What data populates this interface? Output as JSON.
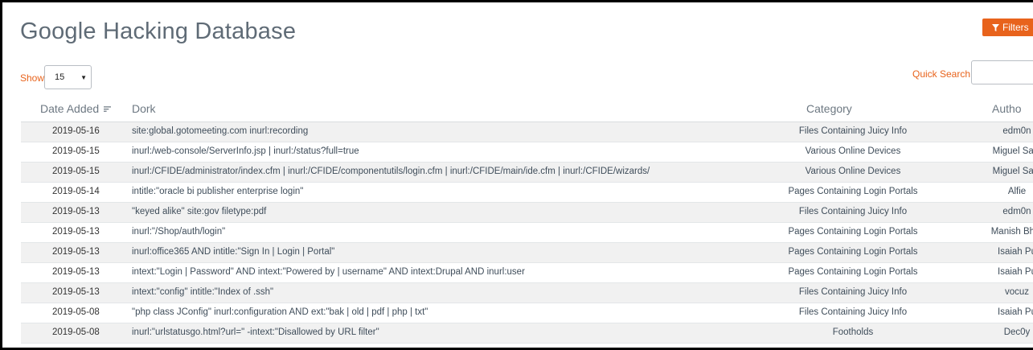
{
  "header": {
    "title": "Google Hacking Database",
    "filters_label": "Filters"
  },
  "controls": {
    "show_label": "Show",
    "show_value": "15",
    "quick_search_label": "Quick Search",
    "quick_search_value": ""
  },
  "columns": {
    "date": "Date Added",
    "dork": "Dork",
    "category": "Category",
    "author": "Autho"
  },
  "rows": [
    {
      "date": "2019-05-16",
      "dork": "site:global.gotomeeting.com inurl:recording",
      "category": "Files Containing Juicy Info",
      "author": "edm0n"
    },
    {
      "date": "2019-05-15",
      "dork": "inurl:/web-console/ServerInfo.jsp | inurl:/status?full=true",
      "category": "Various Online Devices",
      "author": "Miguel Sant"
    },
    {
      "date": "2019-05-15",
      "dork": "inurl:/CFIDE/administrator/index.cfm | inurl:/CFIDE/componentutils/login.cfm | inurl:/CFIDE/main/ide.cfm | inurl:/CFIDE/wizards/",
      "category": "Various Online Devices",
      "author": "Miguel Sant"
    },
    {
      "date": "2019-05-14",
      "dork": "intitle:\"oracle bi publisher enterprise login\"",
      "category": "Pages Containing Login Portals",
      "author": "Alfie"
    },
    {
      "date": "2019-05-13",
      "dork": "\"keyed alike\" site:gov filetype:pdf",
      "category": "Files Containing Juicy Info",
      "author": "edm0n"
    },
    {
      "date": "2019-05-13",
      "dork": "inurl:\"/Shop/auth/login\"",
      "category": "Pages Containing Login Portals",
      "author": "Manish Bhar"
    },
    {
      "date": "2019-05-13",
      "dork": "inurl:office365 AND intitle:\"Sign In | Login | Portal\"",
      "category": "Pages Containing Login Portals",
      "author": "Isaiah Pu"
    },
    {
      "date": "2019-05-13",
      "dork": "intext:\"Login | Password\" AND intext:\"Powered by | username\" AND intext:Drupal AND inurl:user",
      "category": "Pages Containing Login Portals",
      "author": "Isaiah Pu"
    },
    {
      "date": "2019-05-13",
      "dork": "intext:\"config\" intitle:\"Index of .ssh\"",
      "category": "Files Containing Juicy Info",
      "author": "vocuz"
    },
    {
      "date": "2019-05-08",
      "dork": "\"php class JConfig\" inurl:configuration AND ext:\"bak | old | pdf | php | txt\"",
      "category": "Files Containing Juicy Info",
      "author": "Isaiah Pu"
    },
    {
      "date": "2019-05-08",
      "dork": "inurl:\"urlstatusgo.html?url=\" -intext:\"Disallowed by URL filter\"",
      "category": "Footholds",
      "author": "Dec0y"
    }
  ],
  "colors": {
    "accent": "#e8631c",
    "row_stripe": "#f1f1f1",
    "text": "#3f4d5a"
  }
}
